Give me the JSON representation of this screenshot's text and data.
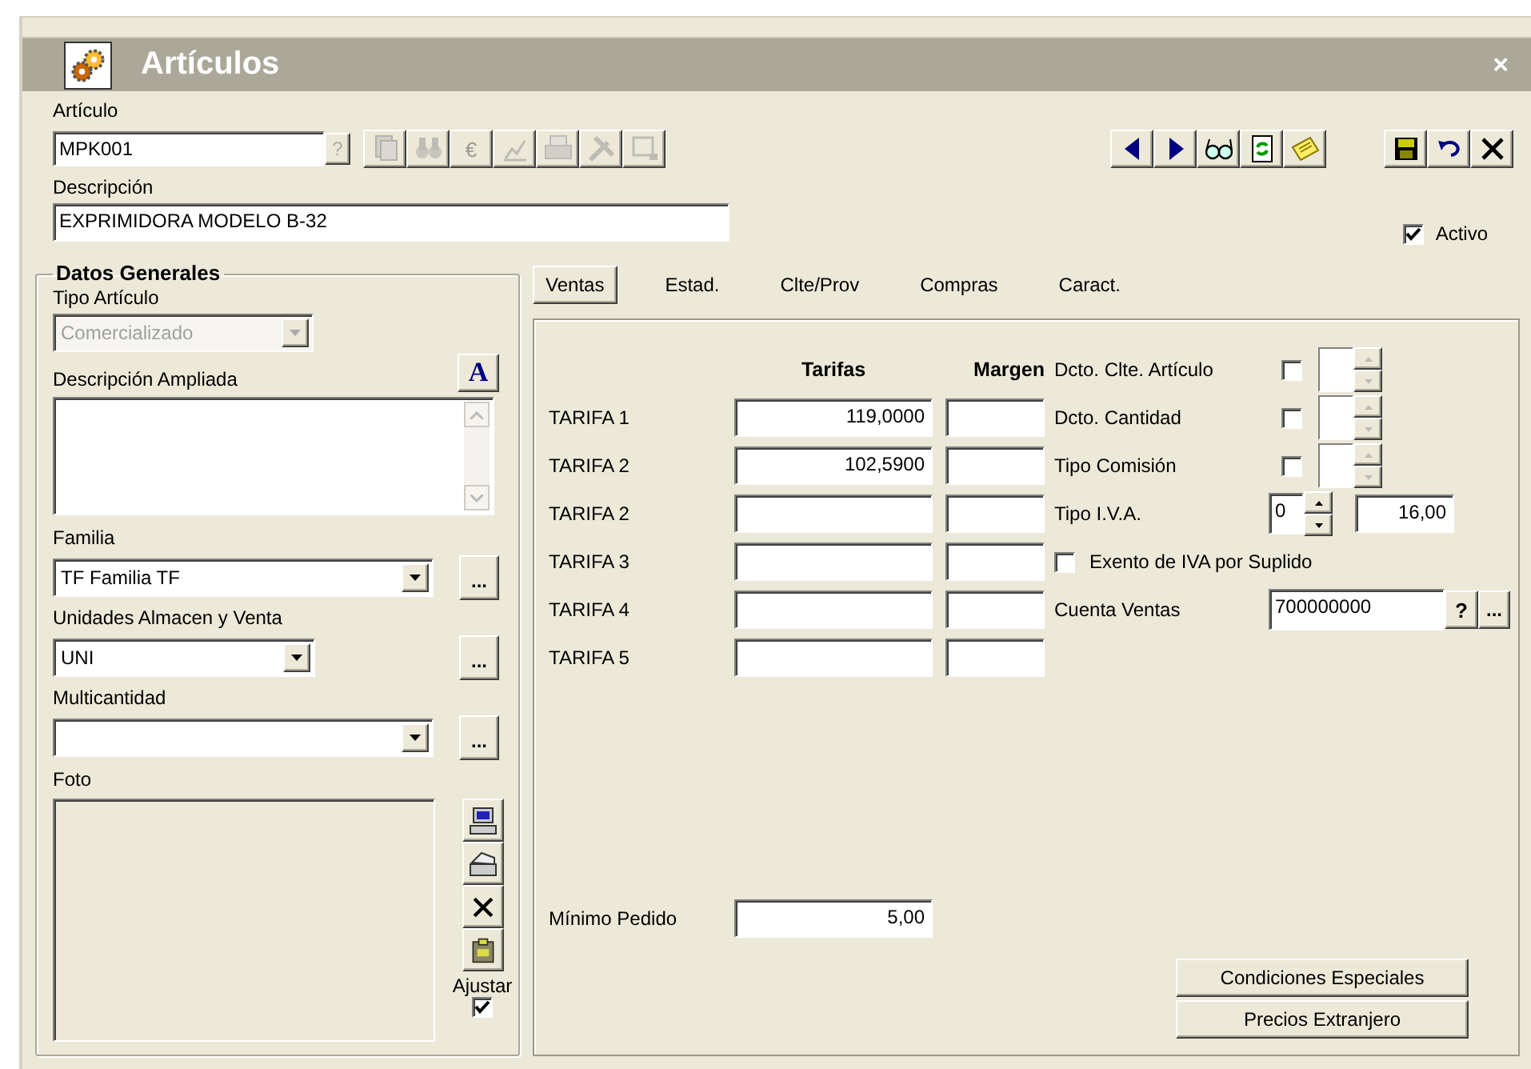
{
  "window": {
    "title": "Artículos",
    "close": "×"
  },
  "articulo": {
    "label": "Artículo",
    "value": "MPK001",
    "help": "?",
    "help_disabled": true
  },
  "record_toolbar": [
    {
      "kind": "document",
      "disabled": true
    },
    {
      "kind": "binoculars",
      "disabled": true
    },
    {
      "kind": "text",
      "label": "€",
      "disabled": true
    },
    {
      "kind": "chart",
      "disabled": true
    },
    {
      "kind": "printer",
      "disabled": true
    },
    {
      "kind": "tools",
      "disabled": true
    },
    {
      "kind": "window",
      "disabled": true
    }
  ],
  "nav_toolbar": [
    {
      "kind": "previous"
    },
    {
      "kind": "next"
    },
    {
      "kind": "glasses"
    },
    {
      "kind": "refresh"
    },
    {
      "kind": "note"
    }
  ],
  "edit_toolbar": [
    {
      "kind": "save"
    },
    {
      "kind": "undo"
    },
    {
      "kind": "close"
    }
  ],
  "descripcion": {
    "label": "Descripción",
    "value": "EXPRIMIDORA MODELO B-32"
  },
  "activo": {
    "label": "Activo",
    "checked": true
  },
  "datos_generales": {
    "title": "Datos Generales",
    "tipo_articulo": {
      "label": "Tipo Artículo",
      "value": "Comercializado",
      "disabled": true
    },
    "format_button": "A",
    "descripcion_ampliada": {
      "label": "Descripción Ampliada"
    },
    "familia": {
      "label": "Familia",
      "value": "TF Familia TF",
      "more": "..."
    },
    "unidades": {
      "label": "Unidades Almacen y Venta",
      "value": "UNI",
      "more": "..."
    },
    "multicantidad": {
      "label": "Multicantidad",
      "more": "..."
    },
    "foto": {
      "label": "Foto"
    },
    "ajustar": {
      "label": "Ajustar",
      "checked": true
    }
  },
  "tabs": [
    {
      "label": "Ventas",
      "selected": true
    },
    {
      "label": "Estad.",
      "selected": false
    },
    {
      "label": "Clte/Prov",
      "selected": false
    },
    {
      "label": "Compras",
      "selected": false
    },
    {
      "label": "Caract.",
      "selected": false
    }
  ],
  "ventas": {
    "columns": [
      "Tarifas",
      "Margen"
    ],
    "tarifas": [
      {
        "label": "TARIFA 1",
        "value": "119,0000"
      },
      {
        "label": "TARIFA 2",
        "value": "102,5900"
      },
      {
        "label": "TARIFA 2"
      },
      {
        "label": "TARIFA 3"
      },
      {
        "label": "TARIFA 4"
      },
      {
        "label": "TARIFA 5"
      }
    ],
    "options": [
      {
        "kind": "check_spin",
        "label": "Dcto. Clte. Artículo",
        "checked": false
      },
      {
        "kind": "check_spin",
        "label": "Dcto. Cantidad",
        "checked": false
      },
      {
        "kind": "check_spin",
        "label": "Tipo Comisión",
        "checked": false
      },
      {
        "kind": "iva",
        "label": "Tipo I.V.A.",
        "code": "0",
        "value": "16,00"
      },
      {
        "kind": "check",
        "label": "Exento de IVA por Suplido",
        "checked": false
      },
      {
        "kind": "account",
        "label": "Cuenta Ventas",
        "value": "700000000",
        "help": "?",
        "more": "..."
      }
    ],
    "minimo_pedido": {
      "label": "Mínimo Pedido",
      "value": "5,00"
    },
    "buttons": [
      "Condiciones Especiales",
      "Precios Extranjero"
    ]
  }
}
